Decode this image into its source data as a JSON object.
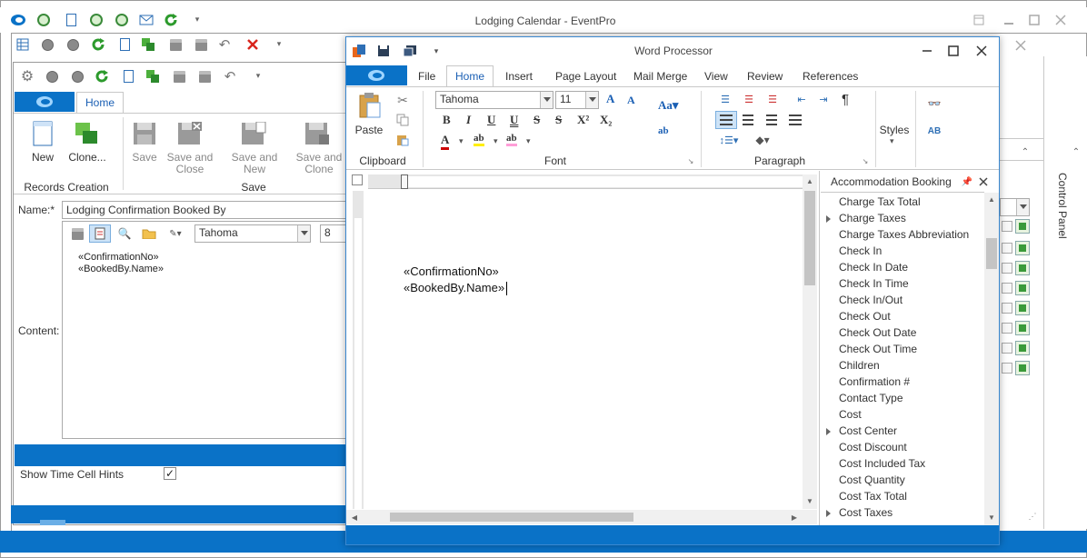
{
  "main_window": {
    "title": "Lodging Calendar - EventPro"
  },
  "record_window": {
    "tab_home": "Home",
    "ribbon": {
      "new": "New",
      "clone": "Clone...",
      "save": "Save",
      "save_close_1": "Save and",
      "save_close_2": "Close",
      "save_new": "Save and New",
      "save_clone_1": "Save and",
      "save_clone_2": "Clone",
      "group_records": "Records Creation",
      "group_save": "Save"
    },
    "name_label": "Name:*",
    "name_value": "Lodging Confirmation Booked By",
    "font_name": "Tahoma",
    "font_size": "8",
    "content_label": "Content:",
    "content_lines": [
      "«ConfirmationNo»",
      "«BookedBy.Name»"
    ],
    "hint_label": "Show Time Cell Hints",
    "hint_checked": true
  },
  "word_processor": {
    "title": "Word Processor",
    "tabs": [
      "File",
      "Home",
      "Insert",
      "Page Layout",
      "Mail Merge",
      "View",
      "Review",
      "References"
    ],
    "active_tab": "Home",
    "paste": "Paste",
    "font_name": "Tahoma",
    "font_size": "11",
    "styles": "Styles",
    "groups": {
      "clipboard": "Clipboard",
      "font": "Font",
      "paragraph": "Paragraph"
    },
    "document_lines": [
      "«ConfirmationNo»",
      "«BookedBy.Name»"
    ],
    "pane": {
      "title": "Accommodation Booking",
      "items": [
        {
          "label": "Charge Tax Total",
          "expandable": false
        },
        {
          "label": "Charge Taxes",
          "expandable": true
        },
        {
          "label": "Charge Taxes Abbreviation",
          "expandable": false
        },
        {
          "label": "Check In",
          "expandable": false
        },
        {
          "label": "Check In Date",
          "expandable": false
        },
        {
          "label": "Check In Time",
          "expandable": false
        },
        {
          "label": "Check In/Out",
          "expandable": false
        },
        {
          "label": "Check Out",
          "expandable": false
        },
        {
          "label": "Check Out Date",
          "expandable": false
        },
        {
          "label": "Check Out Time",
          "expandable": false
        },
        {
          "label": "Children",
          "expandable": false
        },
        {
          "label": "Confirmation #",
          "expandable": false
        },
        {
          "label": "Contact Type",
          "expandable": false
        },
        {
          "label": "Cost",
          "expandable": false
        },
        {
          "label": "Cost Center",
          "expandable": true
        },
        {
          "label": "Cost Discount",
          "expandable": false
        },
        {
          "label": "Cost Included Tax",
          "expandable": false
        },
        {
          "label": "Cost Quantity",
          "expandable": false
        },
        {
          "label": "Cost Tax Total",
          "expandable": false
        },
        {
          "label": "Cost Taxes",
          "expandable": true
        }
      ]
    }
  },
  "control_panel": "Control Panel",
  "colors": {
    "accent": "#0a72c7",
    "active_tab_text": "#1a5fb4"
  }
}
